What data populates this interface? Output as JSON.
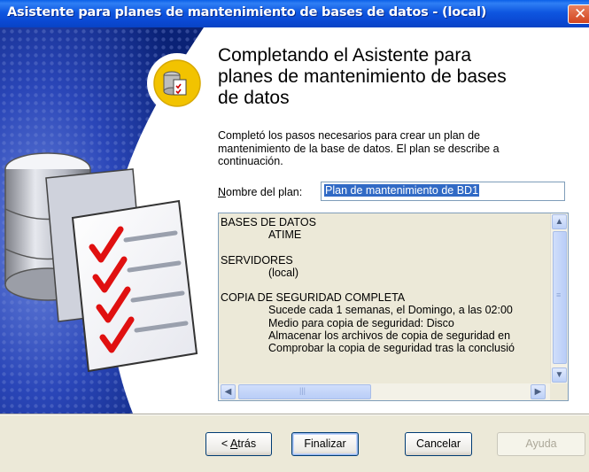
{
  "window": {
    "title": "Asistente para planes de mantenimiento de bases de datos - (local)",
    "close_glyph": "✕"
  },
  "icons": {
    "top_icon": "database-checklist-icon",
    "side_art": "database-with-checklist-art"
  },
  "page": {
    "heading_line1": "Completando el Asistente para",
    "heading_line2": "planes de mantenimiento de bases",
    "heading_line3": "de datos",
    "desc_line1": "Completó los pasos necesarios para crear un plan de",
    "desc_line2": "mantenimiento de la base de datos. El plan se describe a",
    "desc_line3": "continuación.",
    "plan_label_accel": "N",
    "plan_label_rest": "ombre del plan:",
    "plan_name": "Plan de mantenimiento de BD1"
  },
  "summary": {
    "lines": [
      "BASES DE DATOS",
      "ATIME",
      "SERVIDORES",
      "(local)",
      "COPIA DE SEGURIDAD COMPLETA",
      "Sucede cada 1 semanas, el Domingo, a las 02:00",
      "Medio para copia de seguridad: Disco",
      "Almacenar los archivos de copia de seguridad en",
      "Comprobar la copia de seguridad tras la conclusió"
    ]
  },
  "buttons": {
    "back_accel": "A",
    "back_prefix": "< ",
    "back_rest": "trás",
    "finish": "Finalizar",
    "cancel": "Cancelar",
    "help": "Ayuda"
  },
  "colors": {
    "titlebar": "#0a48d2",
    "left_panel": "#0c2a86",
    "check": "#e01010",
    "selection": "#316ac5"
  }
}
